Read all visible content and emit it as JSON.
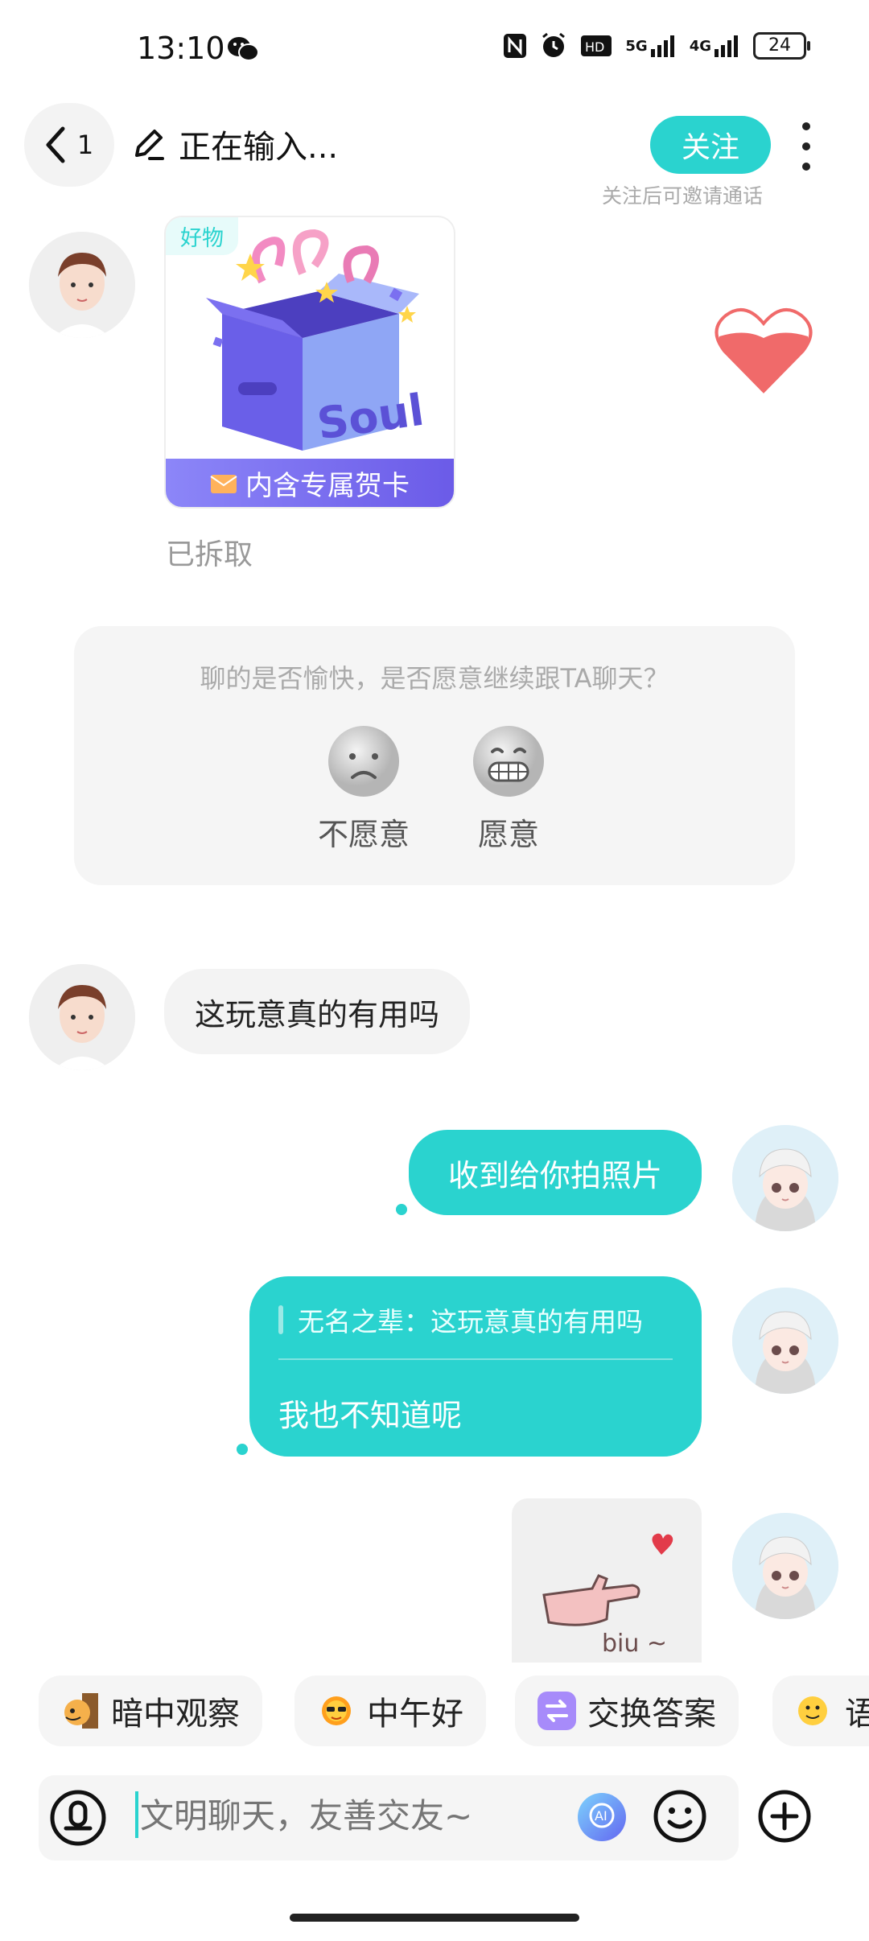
{
  "status_bar": {
    "time": "13:10",
    "network_1": "5G",
    "network_2": "4G",
    "battery": "24"
  },
  "header": {
    "back_count": "1",
    "typing_status": "正在输入...",
    "follow_label": "关注",
    "follow_hint": "关注后可邀请通话"
  },
  "gift": {
    "tag": "好物",
    "brand": "Soul",
    "banner": "内含专属贺卡",
    "status": "已拆取"
  },
  "survey": {
    "question": "聊的是否愉快，是否愿意继续跟TA聊天？",
    "options": [
      "不愿意",
      "愿意"
    ]
  },
  "messages": [
    {
      "side": "left",
      "text": "这玩意真的有用吗"
    },
    {
      "side": "right",
      "text": "收到给你拍照片"
    },
    {
      "side": "right",
      "quote": "无名之辈：这玩意真的有用吗",
      "text": "我也不知道呢"
    },
    {
      "side": "right",
      "sticker_text": "biu ~"
    }
  ],
  "quick_replies": [
    {
      "label": "暗中观察",
      "icon": "peek-dog-icon"
    },
    {
      "label": "中午好",
      "icon": "sun-icon"
    },
    {
      "label": "交换答案",
      "icon": "exchange-icon"
    },
    {
      "label": "语",
      "icon": "smile-emoji-icon"
    }
  ],
  "input": {
    "placeholder": "文明聊天，友善交友~"
  },
  "colors": {
    "accent": "#2ad3cf",
    "bubble_left": "#f3f3f3",
    "heart": "#f06a6a"
  }
}
